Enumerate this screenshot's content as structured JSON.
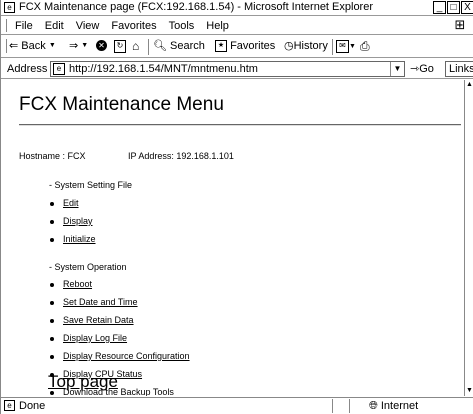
{
  "window": {
    "title": "FCX Maintenance page (FCX:192.168.1.54) - Microsoft Internet Explorer",
    "minimize": "_",
    "maximize": "□",
    "close": "X"
  },
  "menubar": {
    "items": [
      "File",
      "Edit",
      "View",
      "Favorites",
      "Tools",
      "Help"
    ]
  },
  "toolbar": {
    "back": "Back",
    "search": "Search",
    "favorites": "Favorites",
    "history": "History"
  },
  "addressbar": {
    "label": "Address",
    "url": "http://192.168.1.54/MNT/mntmenu.htm",
    "go": "Go",
    "links": "Links"
  },
  "page": {
    "heading": "FCX Maintenance Menu",
    "hostname": "Hostname : FCX",
    "ip_address": "IP Address: 192.168.1.101",
    "sections": [
      {
        "title": "- System Setting File",
        "links": [
          "Edit",
          "Display",
          "Initialize"
        ]
      },
      {
        "title": "- System Operation",
        "links": [
          "Reboot",
          "Set Date and Time",
          "Save Retain Data",
          "Display Log File",
          "Display Resource Configuration",
          "Display CPU Status",
          "Download the Backup Tools"
        ]
      }
    ],
    "top_link": "Top page"
  },
  "statusbar": {
    "status": "Done",
    "zone": "Internet"
  },
  "icons": {
    "window": "ie-page-icon",
    "back": "back-arrow-icon",
    "forward": "forward-arrow-icon",
    "stop": "stop-icon",
    "refresh": "refresh-icon",
    "home": "home-icon",
    "search": "search-icon",
    "favorites": "favorites-icon",
    "history": "history-icon",
    "mail": "mail-icon",
    "print": "print-icon"
  }
}
